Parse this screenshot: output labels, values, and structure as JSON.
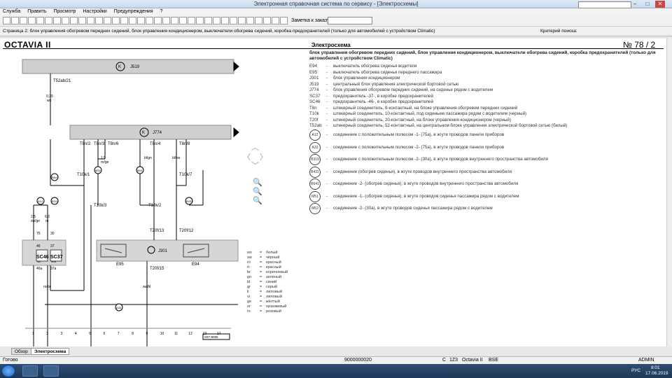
{
  "window": {
    "title": "Электронная справочная система по сервису - [Электросхемы]"
  },
  "menu": [
    "Служба",
    "Править",
    "Просмотр",
    "Настройки",
    "Предупреждения",
    "?"
  ],
  "toolbar": {
    "order_label": "Заметка к заказу:"
  },
  "pathbar": {
    "text": "Страница 2: блок управления обогревом передних сидений, блок управления кондиционером, выключатели обогрева сидений, коробка предохранителей (только для автомобилей с устройством Climatic)",
    "search_label": "Критерий поиска:"
  },
  "doc": {
    "model": "OCTAVIA II",
    "scheme_title": "Электросхема",
    "page_no": "№  78 / 2",
    "description": "блок управления обогревом передних сидений, блок управления кондиционером, выключатели обогрева сидений, коробка предохранителей (только для автомобилей с устройством Climatic)",
    "legend": [
      {
        "code": "E94",
        "text": "выключатель обогрева сиденья водителя"
      },
      {
        "code": "E95",
        "text": "выключатель обогрева сиденья переднего пассажира"
      },
      {
        "code": "J301",
        "text": "блок управления кондиционером"
      },
      {
        "code": "J519",
        "text": "центральный блок управления электрической бортовой сетью"
      },
      {
        "code": "J774",
        "text": "блок управления обогревом передних сидений, на сиденье рядом с водителем"
      },
      {
        "code": "SC37",
        "text": "предохранитель -37-, в коробке предохранителей"
      },
      {
        "code": "SC46",
        "text": "предохранитель -46-, в коробке предохранителей"
      },
      {
        "code": "T8n",
        "text": "штекерный соединитель, 8-контактный, на блоке управления обогревом передних сидений"
      },
      {
        "code": "T10k",
        "text": "штекерный соединитель, 10-контактный, под сиденьем пассажира рядом с водителем (черный)"
      },
      {
        "code": "T20f",
        "text": "штекерный соединитель, 20-контактный, на блоке управления кондиционером (черный)"
      },
      {
        "code": "T52ab",
        "text": "штекерный соединитель, 52-контактный, на центральном блоке управления электрической бортовой сетью (белый)"
      }
    ],
    "grounds": [
      {
        "code": "A12",
        "text": "соединение с положительным полюсом -1- (75a), в жгуте проводов панели приборов"
      },
      {
        "code": "A33",
        "text": "соединение с положительным полюсом -2- (75a), в жгуте проводов панели приборов"
      },
      {
        "code": "B319",
        "text": "соединение с положительным полюсом -2- (30a), в жгуте проводов внутреннего пространства автомобиля"
      },
      {
        "code": "B431",
        "text": "соединение (обогрев сиденья), в жгуте проводов внутреннего пространства автомобиля"
      },
      {
        "code": "B641",
        "text": "соединение -2- (обогрев сиденья), в жгуте проводов внутреннего пространства автомобиля"
      },
      {
        "code": "M51",
        "text": "соединение -1- (обогрев сиденья), в жгуте проводов сиденья пассажира рядом с водителем"
      },
      {
        "code": "M52",
        "text": "соединение -2- (30a), в жгуте проводов сиденья пассажира рядом с водителем"
      }
    ],
    "colors": [
      {
        "code": "ws",
        "name": "белый"
      },
      {
        "code": "sw",
        "name": "чёрный"
      },
      {
        "code": "ro",
        "name": "красный"
      },
      {
        "code": "rt",
        "name": "красный"
      },
      {
        "code": "br",
        "name": "коричневый"
      },
      {
        "code": "gn",
        "name": "зелёный"
      },
      {
        "code": "bl",
        "name": "синий"
      },
      {
        "code": "gr",
        "name": "серый"
      },
      {
        "code": "li",
        "name": "лиловый"
      },
      {
        "code": "vi",
        "name": "лиловый"
      },
      {
        "code": "ge",
        "name": "жёлтый"
      },
      {
        "code": "or",
        "name": "оранжевый"
      },
      {
        "code": "rs",
        "name": "розовый"
      }
    ],
    "schematic_labels": [
      "J519",
      "J774",
      "J301",
      "E95",
      "E94",
      "A12",
      "B319",
      "B641",
      "M51",
      "M52",
      "B431",
      "A33",
      "SC46",
      "SC37",
      "T52ab/21",
      "T8n/2",
      "T8n/3",
      "T8n/6",
      "T8n/4",
      "T8n/8",
      "T10k/1",
      "T10k/7",
      "T10k/3",
      "T10k/2",
      "T20f/13",
      "T20f/12",
      "T20f/15",
      "0,35",
      "ws",
      "2,5",
      "sw/ge",
      "6,0",
      "ro",
      "1,5",
      "ro/ge",
      "bl/gn",
      "bl/ws",
      "sw/bl",
      "ro/br",
      "30",
      "75",
      "37",
      "46",
      "46a",
      "37a",
      "5A",
      "30A",
      "S97-9095"
    ],
    "columns": [
      "1",
      "2",
      "3",
      "4",
      "5",
      "6",
      "7",
      "8",
      "9",
      "10",
      "11",
      "12",
      "13",
      "14"
    ],
    "tabs": [
      "Обзор",
      "Электросхема"
    ],
    "status": {
      "left": "Готово",
      "code": "9000000020",
      "c": "C",
      "eng1": "1Z3",
      "model": "Octavia II",
      "eng2": "BSE",
      "user": "ADMIN"
    },
    "taskbar": {
      "lang": "РУС",
      "time": "8:01",
      "date": "17.06.2019"
    }
  }
}
